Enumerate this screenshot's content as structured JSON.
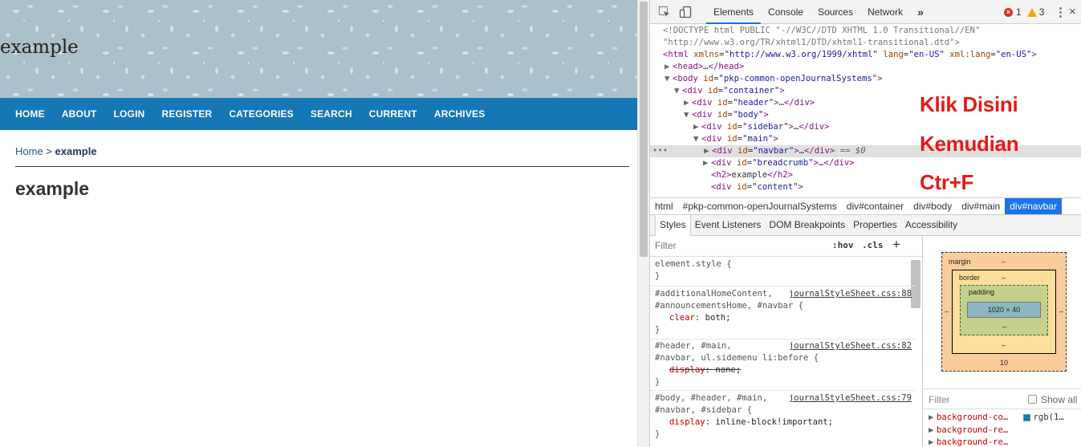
{
  "page": {
    "site_title": "example",
    "nav": [
      "HOME",
      "ABOUT",
      "LOGIN",
      "REGISTER",
      "CATEGORIES",
      "SEARCH",
      "CURRENT",
      "ARCHIVES"
    ],
    "breadcrumb_home": "Home",
    "breadcrumb_sep": " > ",
    "breadcrumb_current": "example",
    "heading": "example",
    "nav_color": "#1577b5"
  },
  "devtools": {
    "tabs": [
      "Elements",
      "Console",
      "Sources",
      "Network"
    ],
    "more_tabs": "»",
    "error_count": "1",
    "warning_count": "3",
    "dom": {
      "doctype_1": "<!DOCTYPE html PUBLIC \"-//W3C//DTD XHTML 1.0 Transitional//EN\"",
      "doctype_2": "\"http://www.w3.org/TR/xhtml1/DTD/xhtml1-transitional.dtd\">",
      "html_xmlns": "http://www.w3.org/1999/xhtml",
      "html_lang": "en-US",
      "html_xmllang": "en-US",
      "body_id": "pkp-common-openJournalSystems",
      "container_id": "container",
      "header_id": "header",
      "body_div_id": "body",
      "sidebar_id": "sidebar",
      "main_id": "main",
      "navbar_id": "navbar",
      "navbar_suffix": " == $0",
      "breadcrumb_id": "breadcrumb",
      "h2_text": "example",
      "content_id": "content"
    },
    "annotations": [
      "Klik Disini",
      "Kemudian",
      "Ctr+F"
    ],
    "breadcrumbs": [
      "html",
      "#pkp-common-openJournalSystems",
      "div#container",
      "div#body",
      "div#main",
      "div#navbar"
    ],
    "styles_tabs": [
      "Styles",
      "Event Listeners",
      "DOM Breakpoints",
      "Properties",
      "Accessibility"
    ],
    "filter_placeholder": "Filter",
    "hov": ":hov",
    "cls": ".cls",
    "rules": [
      {
        "selector": "element.style {",
        "source": "",
        "props": []
      },
      {
        "selector": "#additionalHomeContent,\n#announcementsHome, #navbar {",
        "source": "journalStyleSheet.css:88",
        "props": [
          {
            "name": "clear",
            "value": "both;"
          }
        ]
      },
      {
        "selector": "#header, #main,\n#navbar, ul.sidemenu li:before {",
        "source": "journalStyleSheet.css:82",
        "props": [
          {
            "name": "display",
            "value": "none;",
            "struck": true
          }
        ]
      },
      {
        "selector": "#body, #header, #main,\n#navbar, #sidebar {",
        "source": "journalStyleSheet.css:79",
        "props": [
          {
            "name": "display",
            "value": "inline-block!important;"
          }
        ]
      }
    ],
    "box_model": {
      "margin_label": "margin",
      "border_label": "border",
      "padding_label": "padding",
      "dash": "–",
      "content_size": "1020 × 40",
      "margin_bottom": "10"
    },
    "computed_filter": "Filter",
    "show_all": "Show all",
    "computed": [
      {
        "name": "background-co…",
        "value": "rgb(1…"
      },
      {
        "name": "background-re…",
        "value": ""
      },
      {
        "name": "background-re…",
        "value": ""
      }
    ]
  }
}
